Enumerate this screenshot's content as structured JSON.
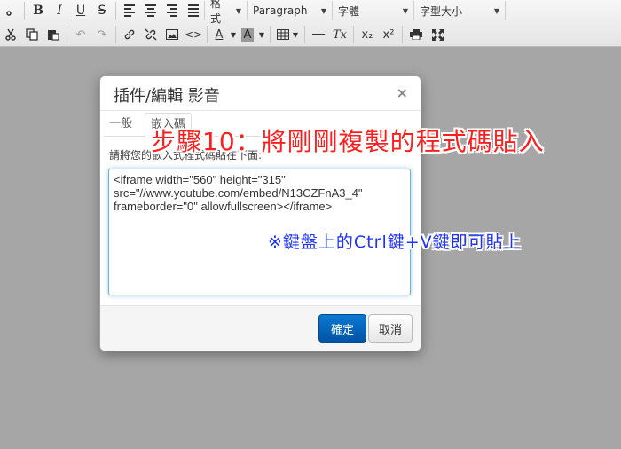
{
  "toolbar": {
    "row1": {
      "format_label": "格式",
      "block_label": "Paragraph",
      "font_label": "字體",
      "size_label": "字型大小"
    },
    "row2": {
      "text_color_glyph": "A",
      "bg_color_glyph": "A",
      "clear_format_glyph": "Tx",
      "subscript_glyph": "x₂",
      "superscript_glyph": "x²"
    }
  },
  "dialog": {
    "title": "插件/編輯 影音",
    "close_glyph": "×",
    "tabs": [
      {
        "label": "一般"
      },
      {
        "label": "嵌入碼"
      }
    ],
    "description": "請將您的嵌入式程式碼貼在下面:",
    "embed_code": "<iframe width=\"560\" height=\"315\" src=\"//www.youtube.com/embed/N13CZFnA3_4\" frameborder=\"0\" allowfullscreen></iframe>",
    "ok_label": "確定",
    "cancel_label": "取消"
  },
  "annotations": {
    "step": "步驟10：將剛剛複製的程式碼貼入",
    "hint": "※鍵盤上的Ctrl鍵+V鍵即可貼上"
  },
  "colors": {
    "primary_button": "#0a6ec4",
    "focus_border": "#66afe9",
    "annotation_red": "#ff1e1e",
    "annotation_blue": "#1e33ff"
  }
}
